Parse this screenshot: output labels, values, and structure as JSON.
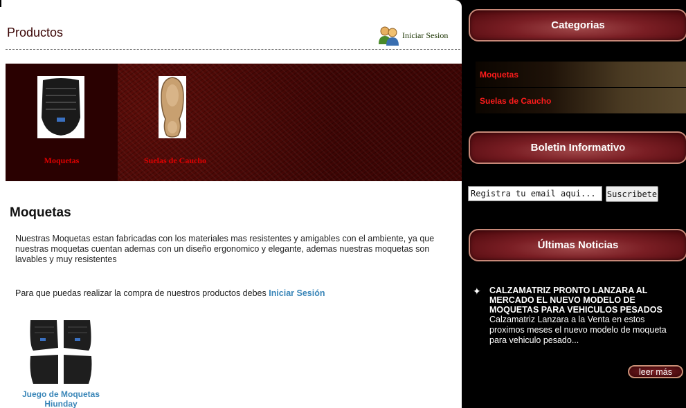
{
  "header": {
    "title": "Productos",
    "login_label": "Iniciar Sesion"
  },
  "categories_strip": [
    {
      "label": "Moquetas",
      "selected": true,
      "icon": "car-floor-mat-icon"
    },
    {
      "label": "Suelas de Caucho",
      "selected": false,
      "icon": "rubber-sole-icon"
    }
  ],
  "content": {
    "section_title": "Moquetas",
    "description": "Nuestras Moquetas estan fabricadas con los materiales mas resistentes y amigables con el ambiente, ya que nuestras moquetas cuentan ademas con un diseño ergonomico y elegante, ademas nuestras moquetas son lavables y muy resistentes",
    "buy_note": "Para que puedas realizar la compra de nuestros productos debes",
    "buy_link": "Iniciar Sesión",
    "product": {
      "name": "Juego de Moquetas Hiunday"
    }
  },
  "sidebar": {
    "categories_title": "Categorias",
    "categories": [
      "Moquetas",
      "Suelas de Caucho"
    ],
    "newsletter_title": "Boletin Informativo",
    "email_placeholder": "Registra tu email aqui...",
    "subscribe_label": "Suscribete",
    "news_title_header": "Últimas Noticias",
    "news": {
      "title": "CALZAMATRIZ PRONTO LANZARA AL MERCADO EL NUEVO MODELO DE MOQUETAS PARA VEHICULOS PESADOS",
      "body": "Calzamatriz Lanzara a la Venta en estos proximos meses el nuevo modelo de moqueta para vehiculo pesado...",
      "read_more": "leer más"
    }
  },
  "colors": {
    "brand_dark_red": "#3d0504",
    "accent_red": "#e00000",
    "link_blue": "#3a86b8"
  }
}
